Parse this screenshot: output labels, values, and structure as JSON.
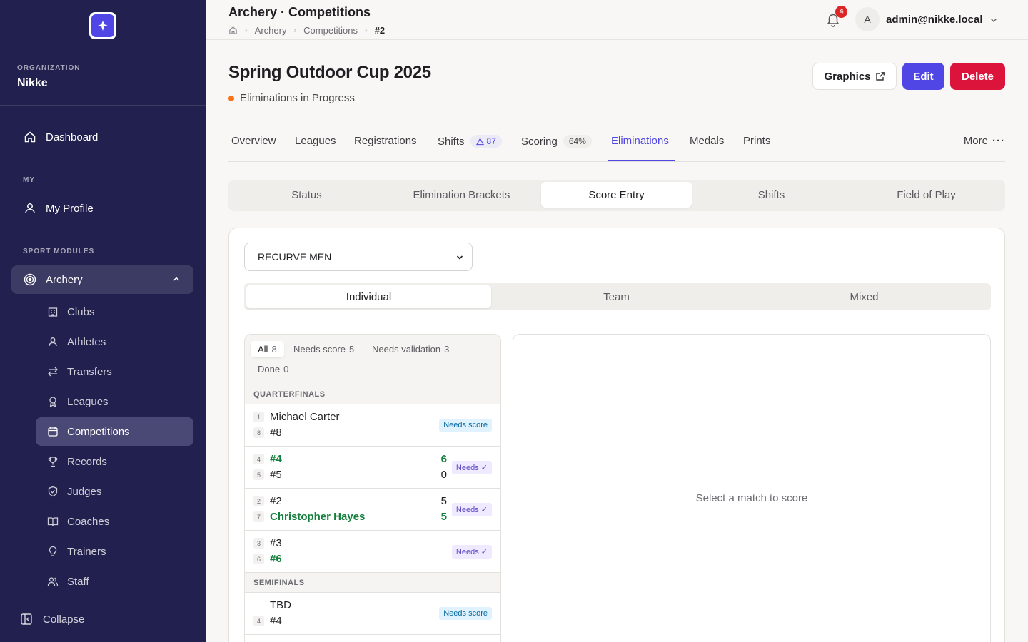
{
  "sidebar": {
    "org_label": "ORGANIZATION",
    "org_name": "Nikke",
    "dashboard": "Dashboard",
    "my_label": "MY",
    "my_profile": "My Profile",
    "sport_label": "SPORT MODULES",
    "archery": "Archery",
    "sub_items": [
      "Clubs",
      "Athletes",
      "Transfers",
      "Leagues",
      "Competitions",
      "Records",
      "Judges",
      "Coaches",
      "Trainers",
      "Staff"
    ],
    "active_sub": "Competitions",
    "collapse": "Collapse"
  },
  "topbar": {
    "title": "Archery · Competitions",
    "breadcrumb": [
      "Archery",
      "Competitions",
      "#2"
    ],
    "notifications": "4",
    "avatar_initial": "A",
    "user_email": "admin@nikke.local"
  },
  "competition": {
    "title": "Spring Outdoor Cup 2025",
    "status": "Eliminations in Progress",
    "status_color": "#f97316",
    "buttons": {
      "graphics": "Graphics",
      "edit": "Edit",
      "delete": "Delete"
    }
  },
  "tabs": [
    {
      "label": "Overview"
    },
    {
      "label": "Leagues"
    },
    {
      "label": "Registrations"
    },
    {
      "label": "Shifts",
      "pill": "87"
    },
    {
      "label": "Scoring",
      "pill": "64%"
    },
    {
      "label": "Eliminations",
      "active": true
    },
    {
      "label": "Medals"
    },
    {
      "label": "Prints"
    }
  ],
  "more_label": "More",
  "subtabs": [
    "Status",
    "Elimination Brackets",
    "Score Entry",
    "Shifts",
    "Field of Play"
  ],
  "active_subtab": "Score Entry",
  "category_select": "RECURVE MEN",
  "segments": [
    "Individual",
    "Team",
    "Mixed"
  ],
  "active_segment": "Individual",
  "filters": [
    {
      "label": "All",
      "count": "8"
    },
    {
      "label": "Needs score",
      "count": "5"
    },
    {
      "label": "Needs validation",
      "count": "3"
    },
    {
      "label": "Done",
      "count": "0"
    }
  ],
  "rounds": [
    {
      "name": "QUARTERFINALS",
      "matches": [
        {
          "a": {
            "seed": "1",
            "name": "Michael Carter",
            "score": ""
          },
          "b": {
            "seed": "8",
            "name": "#8",
            "score": ""
          },
          "tag": "Needs score"
        },
        {
          "a": {
            "seed": "4",
            "name": "#4",
            "score": "6"
          },
          "b": {
            "seed": "5",
            "name": "#5",
            "score": "0"
          },
          "tag": "Needs ✓"
        },
        {
          "a": {
            "seed": "2",
            "name": "#2",
            "score": "5"
          },
          "b": {
            "seed": "7",
            "name": "Christopher Hayes",
            "score": "5"
          },
          "tag": "Needs ✓"
        },
        {
          "a": {
            "seed": "3",
            "name": "#3",
            "score": ""
          },
          "b": {
            "seed": "6",
            "name": "#6",
            "score": ""
          },
          "tag": "Needs ✓"
        }
      ]
    },
    {
      "name": "SEMIFINALS",
      "matches": [
        {
          "a": {
            "seed": "",
            "name": "TBD",
            "score": ""
          },
          "b": {
            "seed": "4",
            "name": "#4",
            "score": ""
          },
          "tag": "Needs score"
        }
      ]
    }
  ],
  "empty_detail": "Select a match to score",
  "colors": {
    "sidebar": "#22204e",
    "accent": "#4f46e5",
    "danger": "#dc143c",
    "win": "#15803d"
  }
}
